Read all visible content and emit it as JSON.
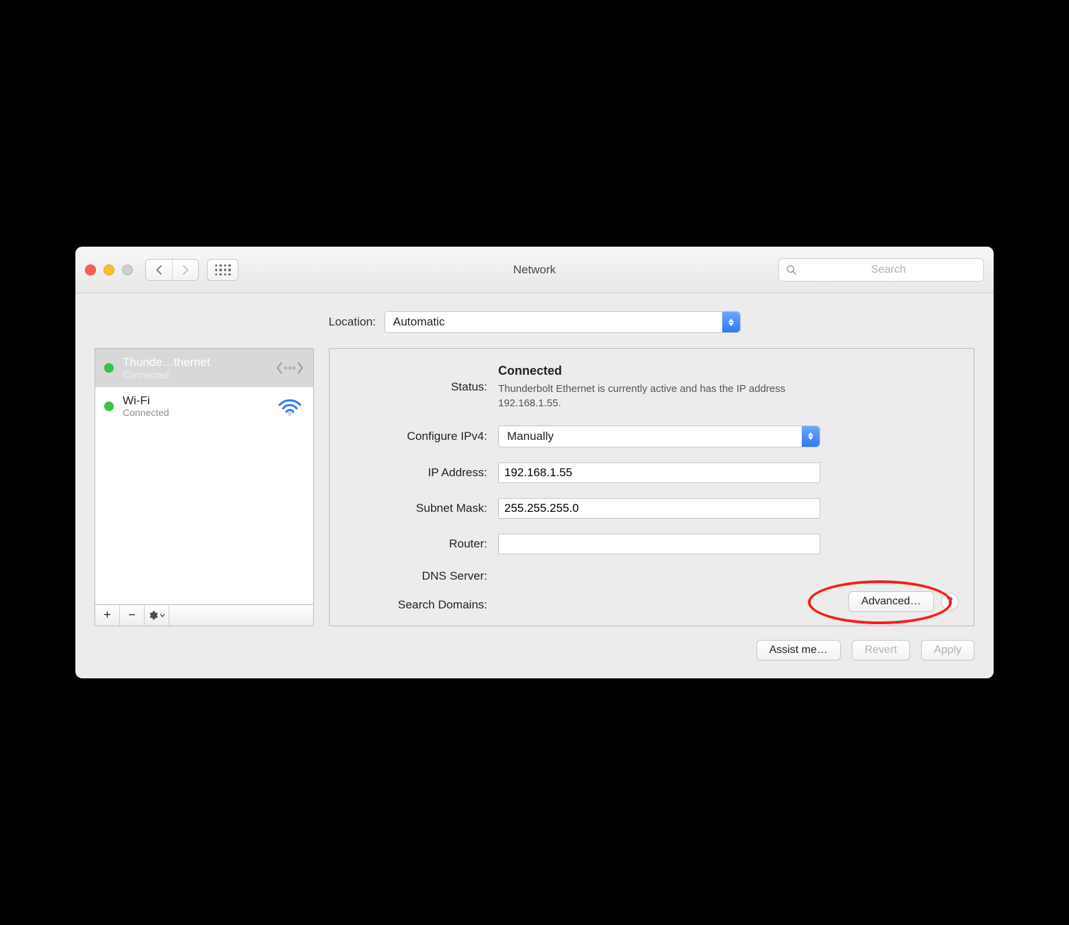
{
  "window": {
    "title": "Network"
  },
  "search": {
    "placeholder": "Search"
  },
  "location": {
    "label": "Location:",
    "value": "Automatic"
  },
  "sidebar": {
    "items": [
      {
        "name": "Thunde…thernet",
        "status": "Connected",
        "icon": "ethernet-icon",
        "selected": true
      },
      {
        "name": "Wi-Fi",
        "status": "Connected",
        "icon": "wifi-icon",
        "selected": false
      }
    ]
  },
  "status": {
    "label": "Status:",
    "value": "Connected",
    "desc": "Thunderbolt Ethernet is currently active and has the IP address 192.168.1.55."
  },
  "fields": {
    "configure_ipv4": {
      "label": "Configure IPv4:",
      "value": "Manually"
    },
    "ip_address": {
      "label": "IP Address:",
      "value": "192.168.1.55"
    },
    "subnet_mask": {
      "label": "Subnet Mask:",
      "value": "255.255.255.0"
    },
    "router": {
      "label": "Router:",
      "value": ""
    },
    "dns_server": {
      "label": "DNS Server:",
      "value": ""
    },
    "search_domains": {
      "label": "Search Domains:",
      "value": ""
    }
  },
  "buttons": {
    "advanced": "Advanced…",
    "assist": "Assist me…",
    "revert": "Revert",
    "apply": "Apply"
  }
}
